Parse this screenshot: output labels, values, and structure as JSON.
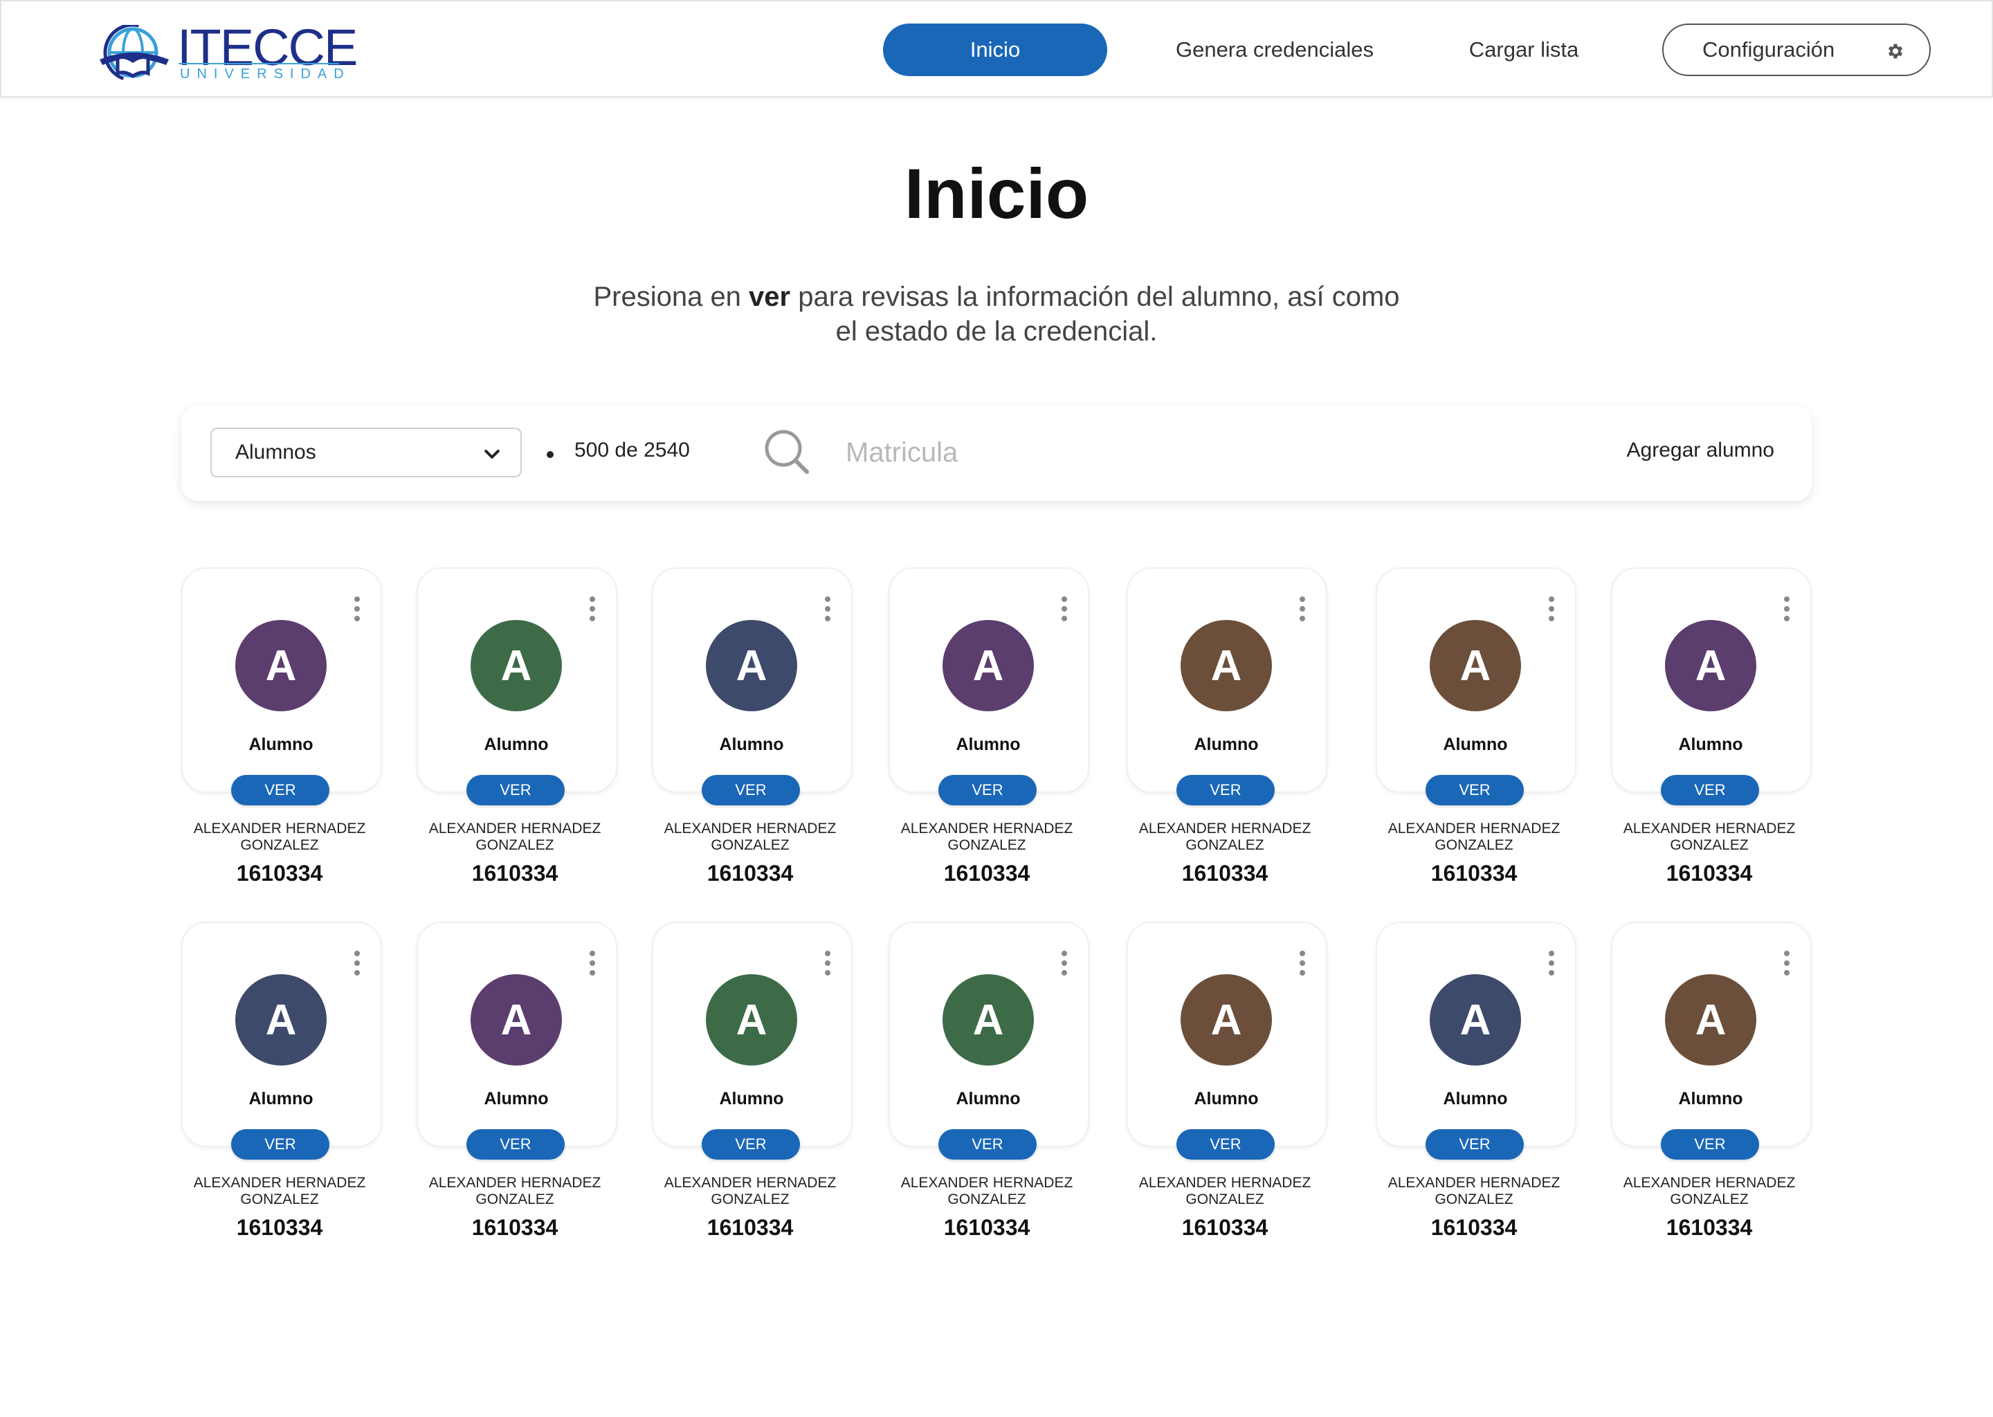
{
  "header": {
    "logo_word": "ITECCE",
    "logo_sub": "UNIVERSIDAD",
    "nav": {
      "inicio": "Inicio",
      "genera": "Genera credenciales",
      "cargar": "Cargar lista",
      "config": "Configuración"
    }
  },
  "page": {
    "title": "Inicio",
    "subtitle_pre": "Presiona en ",
    "subtitle_bold": "ver",
    "subtitle_post": " para revisas la información del alumno, así como el estado de la credencial."
  },
  "toolbar": {
    "select_value": "Alumnos",
    "count": "500 de 2540",
    "search_placeholder": "Matricula",
    "add_label": "Agregar alumno"
  },
  "colors": {
    "accent": "#1a67b8",
    "purple": "#5b3d6e",
    "green": "#3d6b48",
    "navy": "#3e4a6b",
    "brown": "#6b4f3a"
  },
  "cards": [
    {
      "initial": "A",
      "role": "Alumno",
      "ver": "VER",
      "name": "ALEXANDER HERNADEZ GONZALEZ",
      "id": "1610334",
      "color": "#5b3d6e"
    },
    {
      "initial": "A",
      "role": "Alumno",
      "ver": "VER",
      "name": "ALEXANDER HERNADEZ GONZALEZ",
      "id": "1610334",
      "color": "#3d6b48"
    },
    {
      "initial": "A",
      "role": "Alumno",
      "ver": "VER",
      "name": "ALEXANDER HERNADEZ GONZALEZ",
      "id": "1610334",
      "color": "#3e4a6b"
    },
    {
      "initial": "A",
      "role": "Alumno",
      "ver": "VER",
      "name": "ALEXANDER HERNADEZ GONZALEZ",
      "id": "1610334",
      "color": "#5b3d6e"
    },
    {
      "initial": "A",
      "role": "Alumno",
      "ver": "VER",
      "name": "ALEXANDER HERNADEZ GONZALEZ",
      "id": "1610334",
      "color": "#6b4f3a"
    },
    {
      "initial": "A",
      "role": "Alumno",
      "ver": "VER",
      "name": "ALEXANDER HERNADEZ GONZALEZ",
      "id": "1610334",
      "color": "#6b4f3a"
    },
    {
      "initial": "A",
      "role": "Alumno",
      "ver": "VER",
      "name": "ALEXANDER HERNADEZ GONZALEZ",
      "id": "1610334",
      "color": "#5b3d6e"
    },
    {
      "initial": "A",
      "role": "Alumno",
      "ver": "VER",
      "name": "ALEXANDER HERNADEZ GONZALEZ",
      "id": "1610334",
      "color": "#3e4a6b"
    },
    {
      "initial": "A",
      "role": "Alumno",
      "ver": "VER",
      "name": "ALEXANDER HERNADEZ GONZALEZ",
      "id": "1610334",
      "color": "#5b3d6e"
    },
    {
      "initial": "A",
      "role": "Alumno",
      "ver": "VER",
      "name": "ALEXANDER HERNADEZ GONZALEZ",
      "id": "1610334",
      "color": "#3d6b48"
    },
    {
      "initial": "A",
      "role": "Alumno",
      "ver": "VER",
      "name": "ALEXANDER HERNADEZ GONZALEZ",
      "id": "1610334",
      "color": "#3d6b48"
    },
    {
      "initial": "A",
      "role": "Alumno",
      "ver": "VER",
      "name": "ALEXANDER HERNADEZ GONZALEZ",
      "id": "1610334",
      "color": "#6b4f3a"
    },
    {
      "initial": "A",
      "role": "Alumno",
      "ver": "VER",
      "name": "ALEXANDER HERNADEZ GONZALEZ",
      "id": "1610334",
      "color": "#3e4a6b"
    },
    {
      "initial": "A",
      "role": "Alumno",
      "ver": "VER",
      "name": "ALEXANDER HERNADEZ GONZALEZ",
      "id": "1610334",
      "color": "#6b4f3a"
    }
  ]
}
